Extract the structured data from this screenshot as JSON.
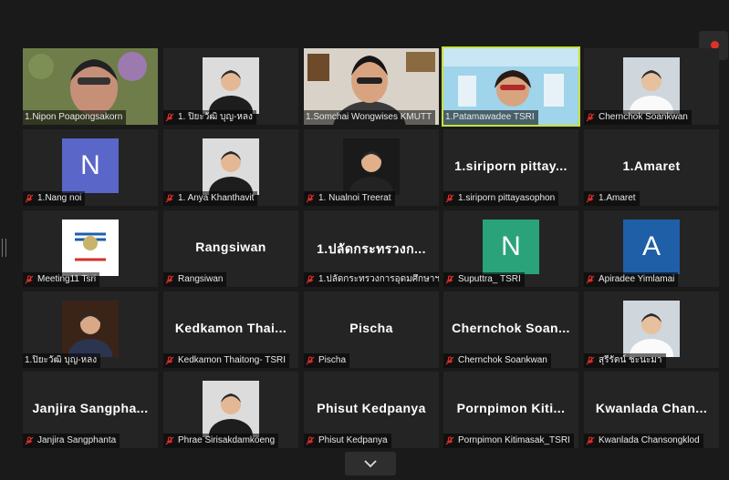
{
  "colors": {
    "active_outline": "#c7e03a",
    "muted_mic": "#e0302a",
    "record": "#e0302a"
  },
  "icons": {
    "record": "record-icon",
    "muted": "mic-muted-icon",
    "collapse": "chevron-down-icon"
  },
  "tiles": [
    {
      "label": "1.Nipon Poapongsakorn",
      "muted": false,
      "kind": "video"
    },
    {
      "label": "1. ปิยะวัฒิ บุญ-หลง",
      "muted": true,
      "kind": "photo"
    },
    {
      "label": "1.Somchai Wongwises KMUTT",
      "muted": false,
      "kind": "video"
    },
    {
      "label": "1.Patamawadee TSRI",
      "muted": false,
      "kind": "video",
      "active": true
    },
    {
      "label": "Chernchok Soankwan",
      "muted": true,
      "kind": "photo"
    },
    {
      "label": "1.Nang noi",
      "muted": true,
      "kind": "letter",
      "letter": "N",
      "avatar_color": "#5a67c8"
    },
    {
      "label": "1. Anya Khanthavit",
      "muted": true,
      "kind": "photo"
    },
    {
      "label": "1. Nualnoi Treerat",
      "muted": true,
      "kind": "photo"
    },
    {
      "label": "1.siriporn pittayasophon",
      "muted": true,
      "kind": "name",
      "display": "1.siriporn pittay..."
    },
    {
      "label": "1.Amaret",
      "muted": true,
      "kind": "name",
      "display": "1.Amaret"
    },
    {
      "label": "Meeting11 Tsri",
      "muted": true,
      "kind": "photo"
    },
    {
      "label": "Rangsiwan",
      "muted": true,
      "kind": "name",
      "display": "Rangsiwan"
    },
    {
      "label": "1.ปลัดกระทรวงการอุดมศึกษาฯ (ศ...",
      "muted": true,
      "kind": "name",
      "display": "1.ปลัดกระทรวงก..."
    },
    {
      "label": "Suputtra_ TSRI",
      "muted": true,
      "kind": "letter",
      "letter": "N",
      "avatar_color": "#2aa37a"
    },
    {
      "label": "Apiradee Yimlamai",
      "muted": true,
      "kind": "letter",
      "letter": "A",
      "avatar_color": "#1f5fa8"
    },
    {
      "label": "1.ปิยะวัฒิ บุญ-หลง",
      "muted": false,
      "kind": "photo"
    },
    {
      "label": "Kedkamon Thaitong- TSRI",
      "muted": true,
      "kind": "name",
      "display": "Kedkamon  Thai..."
    },
    {
      "label": "Pischa",
      "muted": true,
      "kind": "name",
      "display": "Pischa"
    },
    {
      "label": "Chernchok Soankwan",
      "muted": true,
      "kind": "name",
      "display": "Chernchok  Soan..."
    },
    {
      "label": "สุรีรัตน์ ชะนะมา",
      "muted": true,
      "kind": "photo"
    },
    {
      "label": "Janjira Sangphanta",
      "muted": true,
      "kind": "name",
      "display": "Janjira  Sangpha..."
    },
    {
      "label": "Phrae Sirisakdamkoeng",
      "muted": true,
      "kind": "photo"
    },
    {
      "label": "Phisut Kedpanya",
      "muted": true,
      "kind": "name",
      "display": "Phisut  Kedpanya"
    },
    {
      "label": "Pornpimon Kitimasak_TSRI",
      "muted": true,
      "kind": "name",
      "display": "Pornpimon  Kiti..."
    },
    {
      "label": "Kwanlada Chansongklod",
      "muted": true,
      "kind": "name",
      "display": "Kwanlada  Chan..."
    }
  ]
}
